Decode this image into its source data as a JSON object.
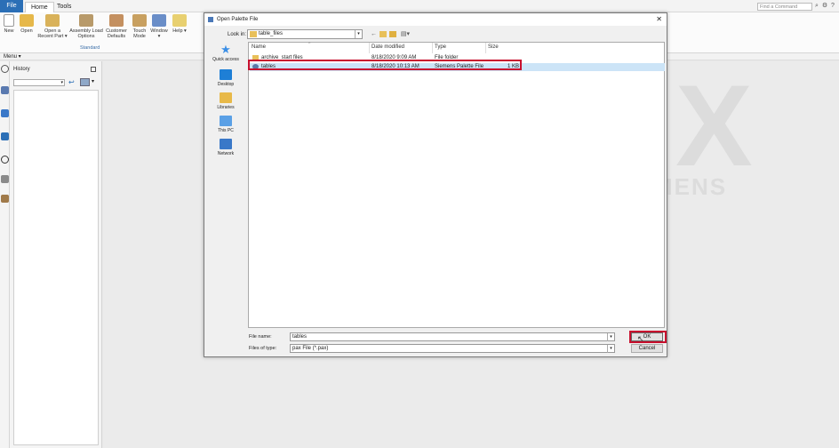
{
  "app": {
    "tabs": [
      {
        "label": "File"
      },
      {
        "label": "Home"
      },
      {
        "label": "Tools"
      }
    ],
    "find_command_placeholder": "Find a Command",
    "ribbon": {
      "buttons": [
        {
          "label": "New"
        },
        {
          "label": "Open"
        },
        {
          "label": "Open a Recent Part ▾"
        },
        {
          "label": "Assembly Load Options"
        },
        {
          "label": "Customer Defaults"
        },
        {
          "label": "Touch Mode"
        },
        {
          "label": "Window ▾"
        },
        {
          "label": "Help ▾"
        }
      ],
      "group_label": "Standard"
    },
    "menu_label": "Menu ▾"
  },
  "history_panel": {
    "title": "History"
  },
  "watermark": {
    "letter": "X",
    "brand": "MENS"
  },
  "dialog": {
    "title": "Open Palette File",
    "look_in_label": "Look in:",
    "look_in_value": "table_files",
    "places": [
      {
        "label": "Quick access",
        "color": "#3a8ee6"
      },
      {
        "label": "Desktop",
        "color": "#1e7fd6"
      },
      {
        "label": "Libraries",
        "color": "#e8b949"
      },
      {
        "label": "This PC",
        "color": "#5aa0e6"
      },
      {
        "label": "Network",
        "color": "#3a78c8"
      }
    ],
    "columns": [
      "Name",
      "Date modified",
      "Type",
      "Size"
    ],
    "files": [
      {
        "name": "archive_start files",
        "date": "8/18/2020 9:09 AM",
        "type": "File folder",
        "size": "",
        "kind": "folder"
      },
      {
        "name": "tables",
        "date": "8/18/2020 10:13 AM",
        "type": "Siemens Palette File",
        "size": "1 KB",
        "kind": "pax"
      }
    ],
    "file_name_label": "File name:",
    "file_name_value": "tables",
    "file_type_label": "Files of type:",
    "file_type_value": "pax File (*.pax)",
    "ok_label": "OK",
    "cancel_label": "Cancel"
  },
  "colors": {
    "highlight": "#c8102e",
    "selection": "#cce4f7",
    "file_tab": "#2b6fb6"
  }
}
